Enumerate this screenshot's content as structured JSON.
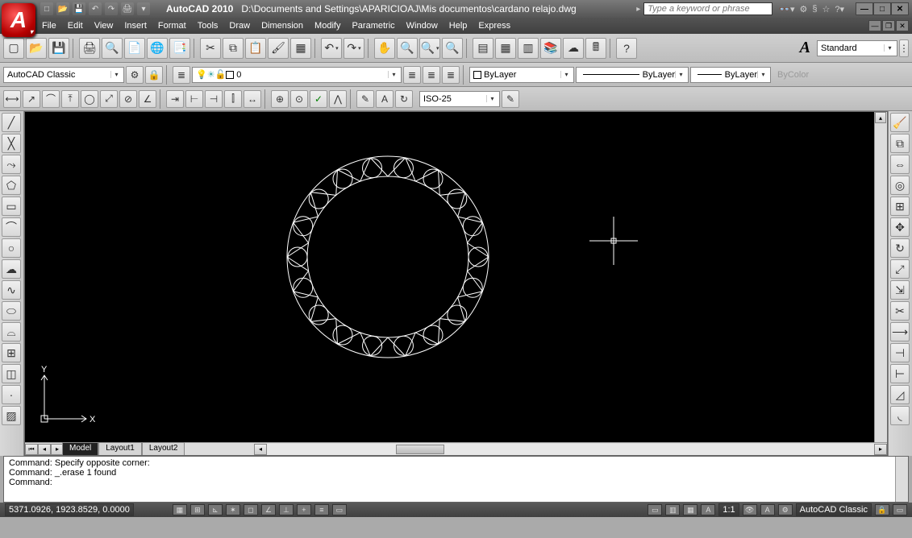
{
  "title": {
    "app": "AutoCAD 2010",
    "file": "D:\\Documents and Settings\\APARICIOAJ\\Mis documentos\\cardano relajo.dwg"
  },
  "search_placeholder": "Type a keyword or phrase",
  "menu": [
    "File",
    "Edit",
    "View",
    "Insert",
    "Format",
    "Tools",
    "Draw",
    "Dimension",
    "Modify",
    "Parametric",
    "Window",
    "Help",
    "Express"
  ],
  "workspace": "AutoCAD Classic",
  "layer_current": "0",
  "prop_color": "ByLayer",
  "prop_linetype": "ByLayer",
  "prop_lineweight": "ByLayer",
  "prop_bycolor": "ByColor",
  "text_style": "Standard",
  "dim_style": "ISO-25",
  "tabs": [
    "Model",
    "Layout1",
    "Layout2"
  ],
  "command_lines": [
    "Command: Specify opposite corner:",
    "Command: _.erase 1 found",
    "",
    "Command:"
  ],
  "status_coords": "5371.0926, 1923.8529, 0.0000",
  "status_scale": "1:1",
  "status_ws": "AutoCAD Classic",
  "ucs": {
    "x": "X",
    "y": "Y"
  }
}
